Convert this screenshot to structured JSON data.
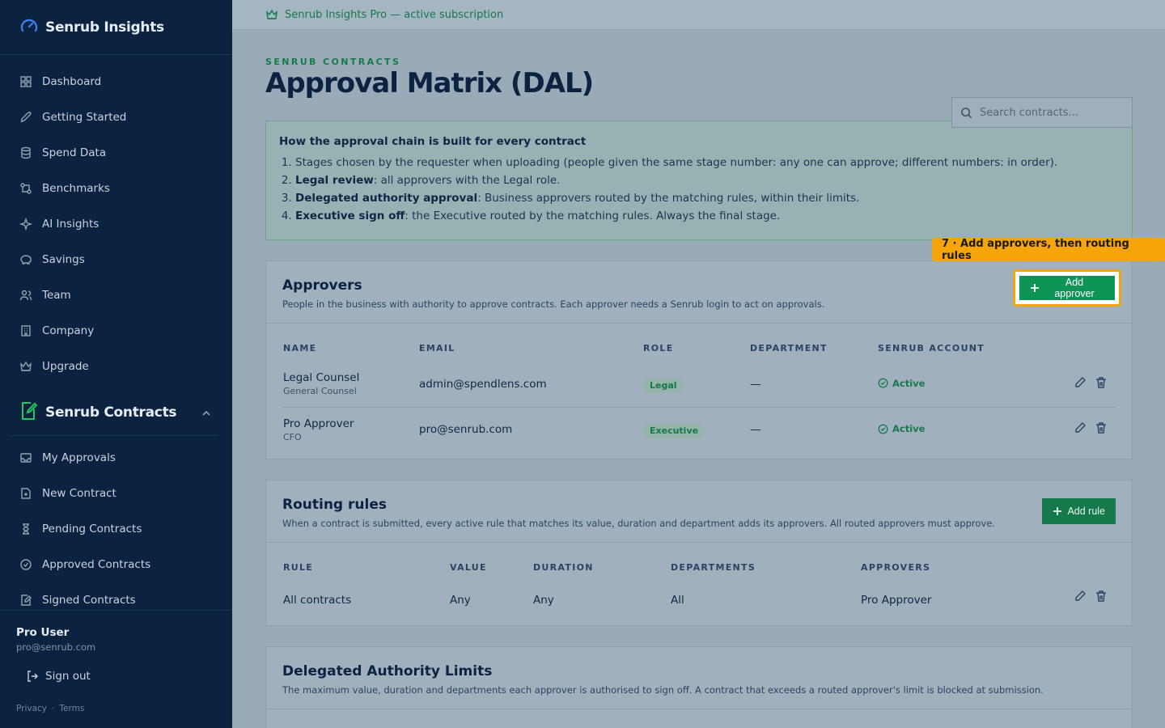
{
  "sidebar": {
    "brand": "Senrub Insights",
    "items": [
      {
        "label": "Dashboard",
        "icon": "grid-icon"
      },
      {
        "label": "Getting Started",
        "icon": "rocket-icon"
      },
      {
        "label": "Spend Data",
        "icon": "database-icon"
      },
      {
        "label": "Benchmarks",
        "icon": "compare-icon"
      },
      {
        "label": "AI Insights",
        "icon": "sparkles-icon"
      },
      {
        "label": "Savings",
        "icon": "piggy-bank-icon"
      },
      {
        "label": "Team",
        "icon": "users-icon"
      },
      {
        "label": "Company",
        "icon": "building-icon"
      },
      {
        "label": "Upgrade",
        "icon": "crown-icon"
      }
    ],
    "section": {
      "title": "Senrub Contracts",
      "items": [
        {
          "label": "My Approvals",
          "icon": "inbox-icon"
        },
        {
          "label": "New Contract",
          "icon": "file-plus-icon"
        },
        {
          "label": "Pending Contracts",
          "icon": "hourglass-icon"
        },
        {
          "label": "Approved Contracts",
          "icon": "check-circle-icon"
        },
        {
          "label": "Signed Contracts",
          "icon": "signature-icon"
        }
      ]
    },
    "user": {
      "name": "Pro User",
      "email": "pro@senrub.com"
    },
    "signout": "Sign out",
    "legal": {
      "privacy": "Privacy",
      "sep": "·",
      "terms": "Terms"
    }
  },
  "banner": "Senrub Insights Pro — active subscription",
  "header": {
    "eyebrow": "SENRUB CONTRACTS",
    "title": "Approval Matrix (DAL)",
    "search_placeholder": "Search contracts..."
  },
  "info": {
    "title": "How the approval chain is built for every contract",
    "steps": [
      {
        "bold": "",
        "text": "Stages chosen by the requester when uploading (people given the same stage number: any one can approve; different numbers: in order)."
      },
      {
        "bold": "Legal review",
        "text": ": all approvers with the Legal role."
      },
      {
        "bold": "Delegated authority approval",
        "text": ": Business approvers routed by the matching rules, within their limits."
      },
      {
        "bold": "Executive sign off",
        "text": ": the Executive routed by the matching rules. Always the final stage."
      }
    ]
  },
  "callout": "7 · Add approvers, then routing rules",
  "approvers": {
    "title": "Approvers",
    "subtitle": "People in the business with authority to approve contracts. Each approver needs a Senrub login to act on approvals.",
    "button": "Add approver",
    "columns": [
      "NAME",
      "EMAIL",
      "ROLE",
      "DEPARTMENT",
      "SENRUB ACCOUNT"
    ],
    "rows": [
      {
        "name": "Legal Counsel",
        "title": "General Counsel",
        "email": "admin@spendlens.com",
        "role": "Legal",
        "department": "—",
        "account": "Active"
      },
      {
        "name": "Pro Approver",
        "title": "CFO",
        "email": "pro@senrub.com",
        "role": "Executive",
        "department": "—",
        "account": "Active"
      }
    ]
  },
  "routing": {
    "title": "Routing rules",
    "subtitle": "When a contract is submitted, every active rule that matches its value, duration and department adds its approvers. All routed approvers must approve.",
    "button": "Add rule",
    "columns": [
      "RULE",
      "VALUE",
      "DURATION",
      "DEPARTMENTS",
      "APPROVERS"
    ],
    "rows": [
      {
        "rule": "All contracts",
        "value": "Any",
        "duration": "Any",
        "departments": "All",
        "approvers": "Pro Approver"
      }
    ]
  },
  "limits": {
    "title": "Delegated Authority Limits",
    "subtitle": "The maximum value, duration and departments each approver is authorised to sign off. A contract that exceeds a routed approver's limit is blocked at submission."
  },
  "colors": {
    "accent": "#147a4b",
    "sidebar": "#0b2341",
    "callout": "#f5a50a"
  }
}
